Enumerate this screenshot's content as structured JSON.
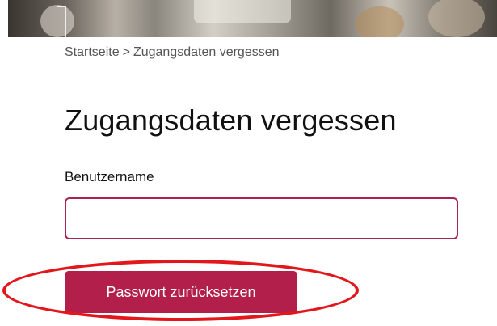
{
  "breadcrumb": {
    "home": "Startseite",
    "separator": ">",
    "current": "Zugangsdaten vergessen"
  },
  "page_title": "Zugangsdaten vergessen",
  "form": {
    "username_label": "Benutzername",
    "username_value": "",
    "submit_label": "Passwort zurücksetzen"
  },
  "colors": {
    "accent": "#b21f4b",
    "input_border": "#a9234f",
    "annotation": "#e2161b"
  }
}
